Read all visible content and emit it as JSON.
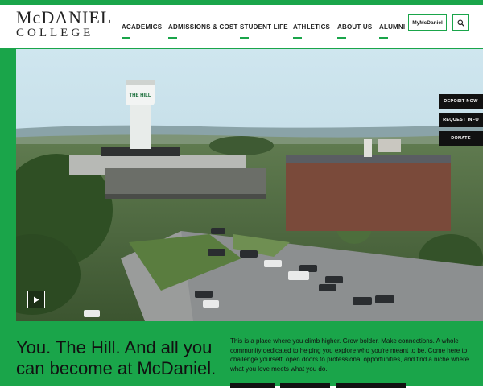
{
  "logo": {
    "line1": "McDANIEL",
    "line2": "COLLEGE"
  },
  "nav": {
    "items": [
      {
        "label": "ACADEMICS"
      },
      {
        "label": "ADMISSIONS & COST"
      },
      {
        "label": "STUDENT LIFE"
      },
      {
        "label": "ATHLETICS"
      },
      {
        "label": "ABOUT US"
      },
      {
        "label": "ALUMNI"
      }
    ],
    "my_label": "MyMcDaniel",
    "search_icon": "search-icon"
  },
  "hero": {
    "tower_text": "THE HILL",
    "side_buttons": [
      {
        "label": "DEPOSIT NOW"
      },
      {
        "label": "REQUEST INFO"
      },
      {
        "label": "DONATE"
      }
    ],
    "play_icon": "play-icon"
  },
  "intro": {
    "headline": "You. The Hill. And all you can become at McDaniel.",
    "body": "This is a place where you climb higher. Grow bolder. Make connections. A whole community dedicated to helping you explore who you're meant to be. Come here to challenge yourself, open doors to professional opportunities, and find a niche where what you love meets what you do."
  },
  "colors": {
    "brand_green": "#1aa54a",
    "dark": "#111111"
  }
}
